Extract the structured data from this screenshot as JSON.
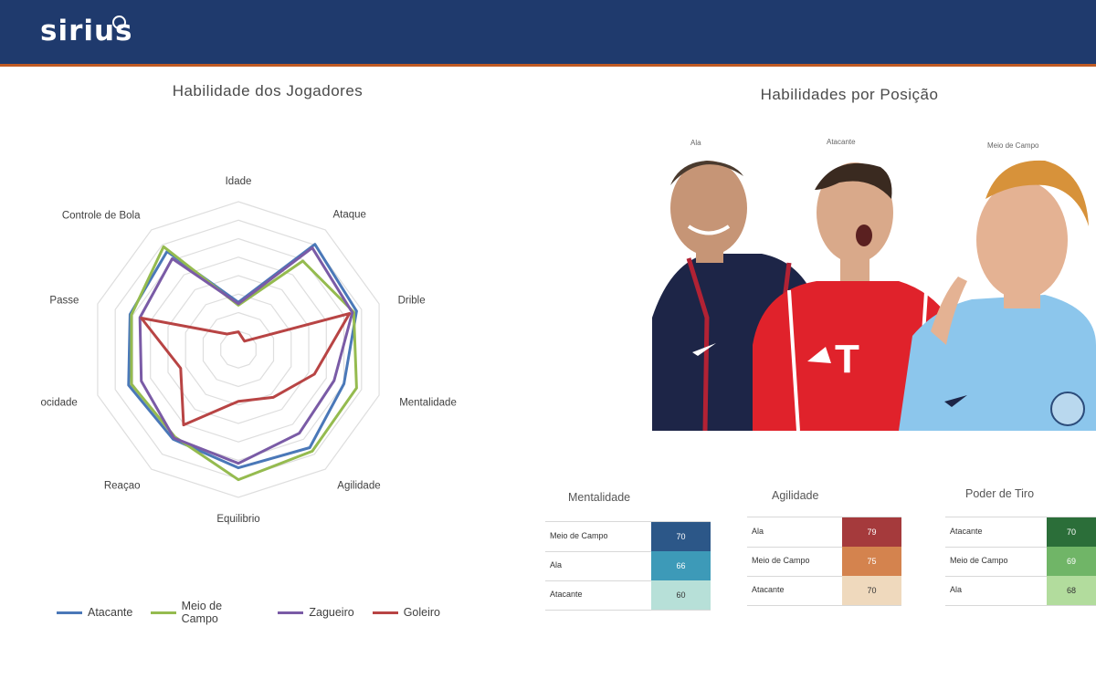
{
  "header": {
    "logo_text": "sirius"
  },
  "radar": {
    "title": "Habilidade dos Jogadores"
  },
  "chart_data": [
    {
      "type": "radar",
      "title": "Habilidade dos Jogadores",
      "axes": [
        "Idade",
        "Ataque",
        "Drible",
        "Mentalidade",
        "Agilidade",
        "Equilibrio",
        "Reaçao",
        "Velocidade",
        "Passe",
        "Controle de Bola"
      ],
      "axis_labels_visible": [
        "Idade",
        "Ataque",
        "Drible",
        "Mentalidade",
        "Agilidade",
        "Equilibrio",
        "Reaçao",
        "ocidade",
        "Passe",
        "Controle de Bola"
      ],
      "rings": 8,
      "range": [
        0,
        100
      ],
      "legend_position": "bottom",
      "series": [
        {
          "name": "Atacante",
          "color": "#4a78b8",
          "values": [
            32,
            88,
            84,
            75,
            82,
            80,
            75,
            78,
            77,
            82
          ]
        },
        {
          "name": "Meio de Campo",
          "color": "#95bb4f",
          "values": [
            30,
            74,
            82,
            84,
            85,
            88,
            73,
            76,
            76,
            86
          ]
        },
        {
          "name": "Zagueiro",
          "color": "#7a5ba6",
          "values": [
            31,
            85,
            81,
            68,
            70,
            77,
            74,
            69,
            70,
            76
          ]
        },
        {
          "name": "Goleiro",
          "color": "#b84444",
          "values": [
            12,
            7,
            79,
            54,
            40,
            35,
            63,
            41,
            69,
            13
          ]
        }
      ]
    },
    {
      "type": "table",
      "title": "Mentalidade",
      "rows": [
        {
          "label": "Meio de Campo",
          "value": 70,
          "color": "#2c5788"
        },
        {
          "label": "Ala",
          "value": 66,
          "color": "#3d9ab8"
        },
        {
          "label": "Atacante",
          "value": 60,
          "color": "#b7e0d8"
        }
      ]
    },
    {
      "type": "table",
      "title": "Agilidade",
      "rows": [
        {
          "label": "Ala",
          "value": 79,
          "color": "#a53a3c"
        },
        {
          "label": "Meio de Campo",
          "value": 75,
          "color": "#d4834e"
        },
        {
          "label": "Atacante",
          "value": 70,
          "color": "#efd9bd"
        }
      ]
    },
    {
      "type": "table",
      "title": "Poder de Tiro",
      "rows": [
        {
          "label": "Atacante",
          "value": 70,
          "color": "#2b6e39"
        },
        {
          "label": "Meio de Campo",
          "value": 69,
          "color": "#70b567"
        },
        {
          "label": "Ala",
          "value": 68,
          "color": "#b2dc9d"
        }
      ]
    }
  ],
  "positions": {
    "title": "Habilidades por Posição",
    "labels": [
      "Ala",
      "Atacante",
      "Meio de Campo"
    ]
  }
}
